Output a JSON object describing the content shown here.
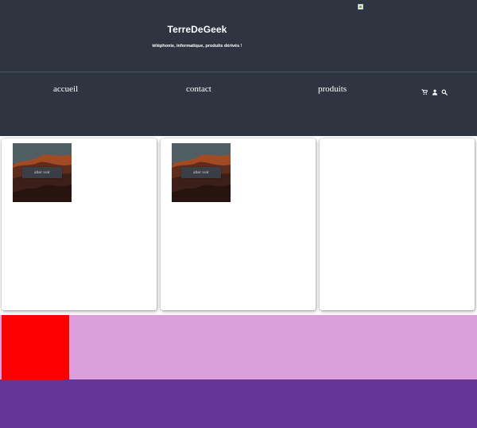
{
  "header": {
    "site_title": "TerreDeGeek",
    "tagline": "téléphonie, informatique, produits dérivés !",
    "background": "#2e3540"
  },
  "nav": {
    "items": [
      {
        "label": "accueil"
      },
      {
        "label": "contact"
      },
      {
        "label": "produits"
      }
    ],
    "icons": [
      "shopping-cart-icon",
      "user-icon",
      "search-icon"
    ]
  },
  "cards": [
    {
      "button_label": "aller voir"
    },
    {
      "button_label": "aller voir"
    },
    {}
  ],
  "colors": {
    "red_block": "#ff0000",
    "pink_band": "#dba0dc",
    "purple_band": "#663397"
  }
}
